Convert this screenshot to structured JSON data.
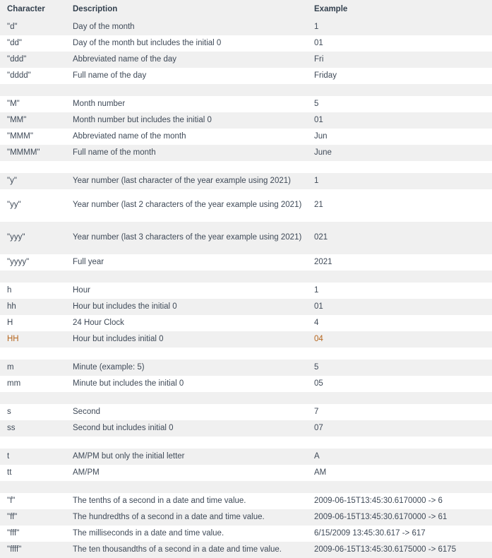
{
  "table": {
    "columns": [
      {
        "key": "character",
        "label": "Character"
      },
      {
        "key": "description",
        "label": "Description"
      },
      {
        "key": "example",
        "label": "Example"
      }
    ],
    "groups": [
      {
        "name": "day-group",
        "rows": [
          {
            "character": "\"d\"",
            "description": "Day of the month",
            "example": "1"
          },
          {
            "character": "\"dd\"",
            "description": "Day of the month but includes the initial 0",
            "example": "01"
          },
          {
            "character": "\"ddd\"",
            "description": "Abbreviated name of the day",
            "example": "Fri"
          },
          {
            "character": "\"dddd\"",
            "description": "Full name of the day",
            "example": "Friday"
          }
        ]
      },
      {
        "name": "month-group",
        "rows": [
          {
            "character": "\"M\"",
            "description": "Month number",
            "example": "5"
          },
          {
            "character": "\"MM\"",
            "description": "Month number but includes the initial 0",
            "example": "01"
          },
          {
            "character": "\"MMM\"",
            "description": "Abbreviated name of the month",
            "example": "Jun"
          },
          {
            "character": "\"MMMM\"",
            "description": "Full name of the month",
            "example": "June"
          }
        ]
      },
      {
        "name": "year-group",
        "rows": [
          {
            "character": "\"y\"",
            "description": "Year number (last character of the year example using 2021)",
            "example": "1",
            "overflow": true
          },
          {
            "character": "\"yy\"",
            "description": "Year number (last 2 characters of the year example using 2021)",
            "example": "21",
            "tall": true
          },
          {
            "character": "\"yyy\"",
            "description": "Year number (last 3 characters of the year example using 2021)",
            "example": "021",
            "tall": true
          },
          {
            "character": "\"yyyy\"",
            "description": "Full year",
            "example": "2021"
          }
        ]
      },
      {
        "name": "hour-group",
        "rows": [
          {
            "character": "h",
            "description": "Hour",
            "example": "1"
          },
          {
            "character": "hh",
            "description": "Hour but includes the initial 0",
            "example": "01"
          },
          {
            "character": "H",
            "description": "24 Hour Clock",
            "example": "4"
          },
          {
            "character": "HH",
            "description": "Hour but includes initial 0",
            "example": "04",
            "accent": true
          }
        ]
      },
      {
        "name": "minute-group",
        "rows": [
          {
            "character": "m",
            "description": "Minute (example: 5)",
            "example": "5"
          },
          {
            "character": "mm",
            "description": "Minute but includes the initial 0",
            "example": "05"
          }
        ]
      },
      {
        "name": "second-group",
        "rows": [
          {
            "character": "s",
            "description": "Second",
            "example": "7"
          },
          {
            "character": "ss",
            "description": "Second but includes initial 0",
            "example": "07"
          }
        ]
      },
      {
        "name": "meridiem-group",
        "rows": [
          {
            "character": "t",
            "description": "AM/PM but only the initial letter",
            "example": "A"
          },
          {
            "character": "tt",
            "description": "AM/PM",
            "example": "AM"
          }
        ]
      },
      {
        "name": "fraction-group",
        "rows": [
          {
            "character": "\"f\"",
            "description": "The tenths of a second in a date and time value.",
            "example": "2009-06-15T13:45:30.6170000 -> 6"
          },
          {
            "character": "\"ff\"",
            "description": "The hundredths of a second in a date and time value.",
            "example": "2009-06-15T13:45:30.6170000 -> 61"
          },
          {
            "character": "\"fff\"",
            "description": "The milliseconds in a date and time value.",
            "example": "6/15/2009 13:45:30.617 -> 617"
          },
          {
            "character": "\"ffff\"",
            "description": "The ten thousandths of a second in a date and time value.",
            "example": "2009-06-15T13:45:30.6175000 -> 6175"
          }
        ]
      }
    ]
  },
  "colors": {
    "page_background": "#ffffff",
    "band_shade": "#f0f0f0",
    "header_background": "#f0f0f0",
    "text": "#3f4a58",
    "header_text": "#33404e",
    "accent_text": "#b5651d"
  }
}
